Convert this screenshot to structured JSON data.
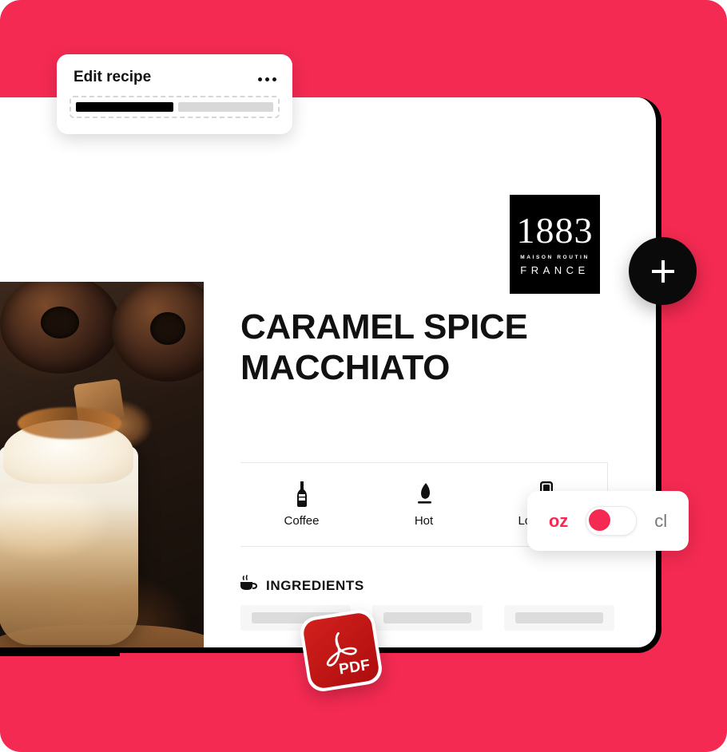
{
  "theme": {
    "brand_red": "#F42A52",
    "black": "#000000",
    "pdf_red": "#C2181A",
    "skeleton_grey": "#DCDCDC"
  },
  "edit_card": {
    "title": "Edit recipe",
    "more_icon": "ellipsis-icon",
    "progress_filled_label": "",
    "progress_empty_label": ""
  },
  "brand_logo": {
    "number": "1883",
    "maison": "MAISON ROUTIN",
    "country": "FRANCE"
  },
  "recipe": {
    "title": "CARAMEL SPICE MACCHIATO",
    "attributes": [
      {
        "icon": "bottle-icon",
        "label": "Coffee"
      },
      {
        "icon": "flame-icon",
        "label": "Hot"
      },
      {
        "icon": "long-glass-icon",
        "label": "Long drink"
      }
    ],
    "ingredients_heading": "INGREDIENTS",
    "ingredients_icon": "coffee-cup-icon",
    "ingredients_placeholders": [
      "",
      "",
      ""
    ]
  },
  "unit_toggle": {
    "left_label": "oz",
    "right_label": "cl",
    "active": "oz"
  },
  "fab": {
    "icon": "plus-icon",
    "label": "+"
  },
  "export": {
    "icon": "pdf-icon",
    "label": "PDF",
    "arrow_icon": "curved-arrow-icon"
  }
}
